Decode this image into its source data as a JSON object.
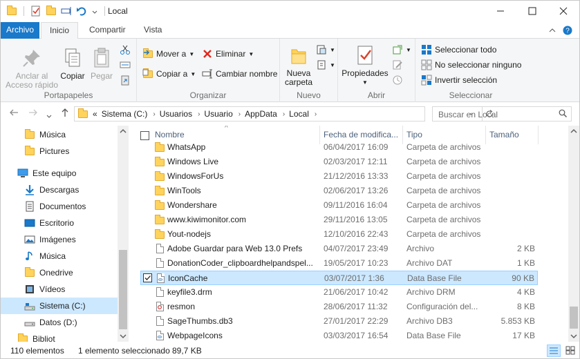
{
  "window": {
    "title": "Local"
  },
  "tabs": [
    {
      "label": "Archivo"
    },
    {
      "label": "Inicio"
    },
    {
      "label": "Compartir"
    },
    {
      "label": "Vista"
    }
  ],
  "ribbon": {
    "portapapeles": {
      "label": "Portapapeles",
      "pin_line1": "Anclar al",
      "pin_line2": "Acceso rápido",
      "copy": "Copiar",
      "paste": "Pegar"
    },
    "organizar": {
      "label": "Organizar",
      "move_to": "Mover a",
      "copy_to": "Copiar a",
      "delete": "Eliminar",
      "rename": "Cambiar nombre"
    },
    "nuevo": {
      "label": "Nuevo",
      "new_folder_line1": "Nueva",
      "new_folder_line2": "carpeta"
    },
    "abrir": {
      "label": "Abrir",
      "properties": "Propiedades"
    },
    "seleccionar": {
      "label": "Seleccionar",
      "select_all": "Seleccionar todo",
      "select_none": "No seleccionar ninguno",
      "invert": "Invertir selección"
    }
  },
  "address": {
    "prefix": "«",
    "crumbs": [
      "Sistema (C:)",
      "Usuarios",
      "Usuario",
      "AppData",
      "Local"
    ],
    "search_placeholder": "Buscar en Local"
  },
  "nav": [
    {
      "label": "Música",
      "icon": "folder-icon"
    },
    {
      "label": "Pictures",
      "icon": "folder-icon"
    },
    {
      "label": "Este equipo",
      "icon": "computer-icon"
    },
    {
      "label": "Descargas",
      "icon": "download-icon"
    },
    {
      "label": "Documentos",
      "icon": "documents-icon"
    },
    {
      "label": "Escritorio",
      "icon": "desktop-icon"
    },
    {
      "label": "Imágenes",
      "icon": "pictures-icon"
    },
    {
      "label": "Música",
      "icon": "music-icon"
    },
    {
      "label": "Onedrive",
      "icon": "folder-icon"
    },
    {
      "label": "Vídeos",
      "icon": "videos-icon"
    },
    {
      "label": "Sistema (C:)",
      "icon": "drive-icon"
    },
    {
      "label": "Datos (D:)",
      "icon": "drive-icon"
    },
    {
      "label": "Bibliot",
      "icon": "library-icon"
    }
  ],
  "columns": {
    "name": "Nombre",
    "date": "Fecha de modifica...",
    "type": "Tipo",
    "size": "Tamaño"
  },
  "files": [
    {
      "name": "WhatsApp",
      "date": "06/04/2017 16:09",
      "type": "Carpeta de archivos",
      "size": "",
      "icon": "folder-icon"
    },
    {
      "name": "Windows Live",
      "date": "02/03/2017 12:11",
      "type": "Carpeta de archivos",
      "size": "",
      "icon": "folder-icon"
    },
    {
      "name": "WindowsForUs",
      "date": "21/12/2016 13:33",
      "type": "Carpeta de archivos",
      "size": "",
      "icon": "folder-icon"
    },
    {
      "name": "WinTools",
      "date": "02/06/2017 13:26",
      "type": "Carpeta de archivos",
      "size": "",
      "icon": "folder-icon"
    },
    {
      "name": "Wondershare",
      "date": "09/11/2016 16:04",
      "type": "Carpeta de archivos",
      "size": "",
      "icon": "folder-icon"
    },
    {
      "name": "www.kiwimonitor.com",
      "date": "29/11/2016 13:05",
      "type": "Carpeta de archivos",
      "size": "",
      "icon": "folder-icon"
    },
    {
      "name": "Yout-nodejs",
      "date": "12/10/2016 22:43",
      "type": "Carpeta de archivos",
      "size": "",
      "icon": "folder-icon"
    },
    {
      "name": "Adobe Guardar para Web 13.0 Prefs",
      "date": "04/07/2017 23:49",
      "type": "Archivo",
      "size": "2 KB",
      "icon": "file-icon"
    },
    {
      "name": "DonationCoder_clipboardhelpandspel...",
      "date": "19/05/2017 10:23",
      "type": "Archivo DAT",
      "size": "1 KB",
      "icon": "file-icon"
    },
    {
      "name": "IconCache",
      "date": "03/07/2017 1:36",
      "type": "Data Base File",
      "size": "90 KB",
      "icon": "database-file-icon",
      "selected": true
    },
    {
      "name": "keyfile3.drm",
      "date": "21/06/2017 10:42",
      "type": "Archivo DRM",
      "size": "4 KB",
      "icon": "file-icon"
    },
    {
      "name": "resmon",
      "date": "28/06/2017 11:32",
      "type": "Configuración del...",
      "size": "8 KB",
      "icon": "config-file-icon"
    },
    {
      "name": "SageThumbs.db3",
      "date": "27/01/2017 22:29",
      "type": "Archivo DB3",
      "size": "5.853 KB",
      "icon": "file-icon"
    },
    {
      "name": "WebpageIcons",
      "date": "03/03/2017 16:54",
      "type": "Data Base File",
      "size": "17 KB",
      "icon": "database-file-icon"
    }
  ],
  "status": {
    "count": "110 elementos",
    "selection": "1 elemento seleccionado",
    "size": "89,7 KB"
  },
  "colors": {
    "accent": "#1979ca",
    "selection": "#cce8ff",
    "selection_border": "#99d1ff",
    "folder": "#ffd35c"
  }
}
